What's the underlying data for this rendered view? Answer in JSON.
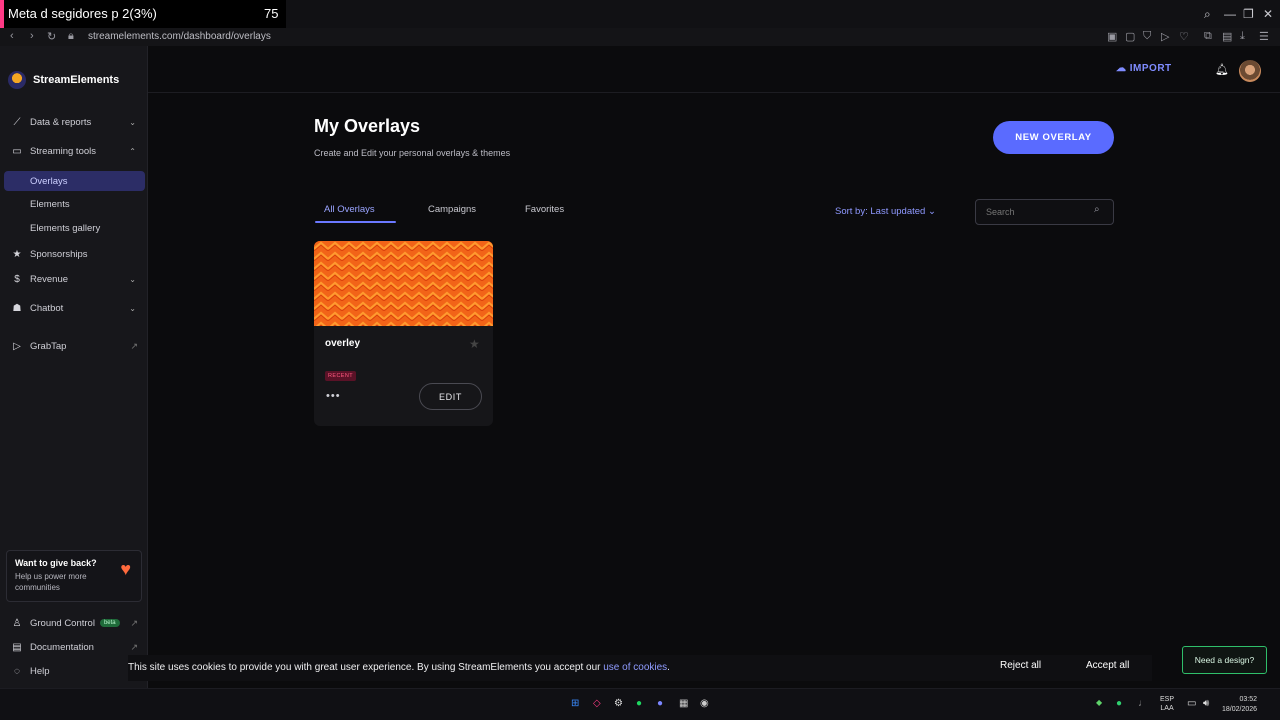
{
  "window": {
    "stream_title": "Meta d segidores p   2(3%)",
    "stream_count": "75",
    "controls": {
      "search": "⌕",
      "minimize": "—",
      "restore": "❐",
      "close": "✕"
    }
  },
  "browser": {
    "url": "streamelements.com/dashboard/overlays"
  },
  "sidebar": {
    "brand": "StreamElements",
    "items": [
      {
        "label": "Data & reports",
        "icon": "chart-icon",
        "chevron": "⌄"
      },
      {
        "label": "Streaming tools",
        "icon": "monitor-icon",
        "chevron": "⌃"
      },
      {
        "label": "Overlays"
      },
      {
        "label": "Elements"
      },
      {
        "label": "Elements gallery"
      },
      {
        "label": "Sponsorships",
        "icon": "star-icon"
      },
      {
        "label": "Revenue",
        "icon": "dollar-icon",
        "chevron": "⌄"
      },
      {
        "label": "Chatbot",
        "icon": "bot-icon",
        "chevron": "⌄"
      },
      {
        "label": "GrabTap",
        "icon": "grabtap-icon"
      }
    ],
    "giveback": {
      "title": "Want to give back?",
      "text": "Help us power more communities"
    },
    "footer": [
      {
        "label": "Ground Control",
        "badge": "beta"
      },
      {
        "label": "Documentation"
      },
      {
        "label": "Help"
      }
    ]
  },
  "header": {
    "import_label": "IMPORT"
  },
  "main": {
    "title": "My Overlays",
    "subtitle": "Create and Edit your personal overlays & themes",
    "new_overlay_label": "NEW OVERLAY",
    "tabs": [
      {
        "label": "All Overlays",
        "active": true
      },
      {
        "label": "Campaigns"
      },
      {
        "label": "Favorites"
      }
    ],
    "sort_label": "Sort by: Last updated",
    "search_placeholder": "Search",
    "overlays": [
      {
        "name": "overley",
        "badge": "RECENT",
        "edit_label": "EDIT",
        "more": "•••"
      }
    ]
  },
  "cookie_banner": {
    "text": "This site uses cookies to provide you with great user experience. By using StreamElements you accept our ",
    "link": "use of cookies",
    "text_end": ".",
    "reject_label": "Reject all",
    "accept_label": "Accept all"
  },
  "need_design_label": "Need a design?",
  "taskbar": {
    "lang_top": "ESP",
    "lang_bottom": "LAA",
    "time": "03:52",
    "date": "18/02/2026"
  },
  "colors": {
    "accent": "#5a6bff",
    "thumb": "#f05a12",
    "active_nav": "#2c2d66"
  }
}
